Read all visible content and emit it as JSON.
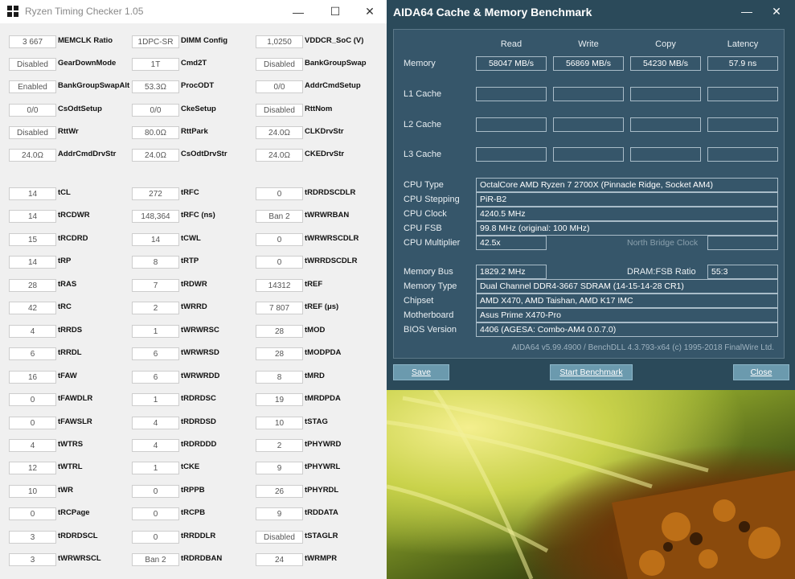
{
  "rtc": {
    "title": "Ryzen Timing Checker 1.05",
    "window_controls": {
      "minimize": "—",
      "maximize": "☐",
      "close": "✕"
    },
    "top_rows": [
      [
        {
          "v": "3 667",
          "l": "MEMCLK Ratio"
        },
        {
          "v": "1DPC-SR",
          "l": "DIMM Config"
        },
        {
          "v": "1,0250",
          "l": "VDDCR_SoC (V)"
        }
      ],
      [
        {
          "v": "Disabled",
          "l": "GearDownMode"
        },
        {
          "v": "1T",
          "l": "Cmd2T"
        },
        {
          "v": "Disabled",
          "l": "BankGroupSwap"
        }
      ],
      [
        {
          "v": "Enabled",
          "l": "BankGroupSwapAlt"
        },
        {
          "v": "53.3Ω",
          "l": "ProcODT"
        },
        {
          "v": "0/0",
          "l": "AddrCmdSetup"
        }
      ],
      [
        {
          "v": "0/0",
          "l": "CsOdtSetup"
        },
        {
          "v": "0/0",
          "l": "CkeSetup"
        },
        {
          "v": "Disabled",
          "l": "RttNom"
        }
      ],
      [
        {
          "v": "Disabled",
          "l": "RttWr"
        },
        {
          "v": "80.0Ω",
          "l": "RttPark"
        },
        {
          "v": "24.0Ω",
          "l": "CLKDrvStr"
        }
      ],
      [
        {
          "v": "24.0Ω",
          "l": "AddrCmdDrvStr"
        },
        {
          "v": "24.0Ω",
          "l": "CsOdtDrvStr"
        },
        {
          "v": "24.0Ω",
          "l": "CKEDrvStr"
        }
      ]
    ],
    "timing_rows": [
      [
        {
          "v": "14",
          "l": "tCL"
        },
        {
          "v": "272",
          "l": "tRFC"
        },
        {
          "v": "0",
          "l": "tRDRDSCDLR"
        }
      ],
      [
        {
          "v": "14",
          "l": "tRCDWR"
        },
        {
          "v": "148,364",
          "l": "tRFC (ns)"
        },
        {
          "v": "Ban 2",
          "l": "tWRWRBAN"
        }
      ],
      [
        {
          "v": "15",
          "l": "tRCDRD"
        },
        {
          "v": "14",
          "l": "tCWL"
        },
        {
          "v": "0",
          "l": "tWRWRSCDLR"
        }
      ],
      [
        {
          "v": "14",
          "l": "tRP"
        },
        {
          "v": "8",
          "l": "tRTP"
        },
        {
          "v": "0",
          "l": "tWRRDSCDLR"
        }
      ],
      [
        {
          "v": "28",
          "l": "tRAS"
        },
        {
          "v": "7",
          "l": "tRDWR"
        },
        {
          "v": "14312",
          "l": "tREF"
        }
      ],
      [
        {
          "v": "42",
          "l": "tRC"
        },
        {
          "v": "2",
          "l": "tWRRD"
        },
        {
          "v": "7 807",
          "l": "tREF (μs)"
        }
      ],
      [
        {
          "v": "4",
          "l": "tRRDS"
        },
        {
          "v": "1",
          "l": "tWRWRSC"
        },
        {
          "v": "28",
          "l": "tMOD"
        }
      ],
      [
        {
          "v": "6",
          "l": "tRRDL"
        },
        {
          "v": "6",
          "l": "tWRWRSD"
        },
        {
          "v": "28",
          "l": "tMODPDA"
        }
      ],
      [
        {
          "v": "16",
          "l": "tFAW"
        },
        {
          "v": "6",
          "l": "tWRWRDD"
        },
        {
          "v": "8",
          "l": "tMRD"
        }
      ],
      [
        {
          "v": "0",
          "l": "tFAWDLR"
        },
        {
          "v": "1",
          "l": "tRDRDSC"
        },
        {
          "v": "19",
          "l": "tMRDPDA"
        }
      ],
      [
        {
          "v": "0",
          "l": "tFAWSLR"
        },
        {
          "v": "4",
          "l": "tRDRDSD"
        },
        {
          "v": "10",
          "l": "tSTAG"
        }
      ],
      [
        {
          "v": "4",
          "l": "tWTRS"
        },
        {
          "v": "4",
          "l": "tRDRDDD"
        },
        {
          "v": "2",
          "l": "tPHYWRD"
        }
      ],
      [
        {
          "v": "12",
          "l": "tWTRL"
        },
        {
          "v": "1",
          "l": "tCKE"
        },
        {
          "v": "9",
          "l": "tPHYWRL"
        }
      ],
      [
        {
          "v": "10",
          "l": "tWR"
        },
        {
          "v": "0",
          "l": "tRPPB"
        },
        {
          "v": "26",
          "l": "tPHYRDL"
        }
      ],
      [
        {
          "v": "0",
          "l": "tRCPage"
        },
        {
          "v": "0",
          "l": "tRCPB"
        },
        {
          "v": "9",
          "l": "tRDDATA"
        }
      ],
      [
        {
          "v": "3",
          "l": "tRDRDSCL"
        },
        {
          "v": "0",
          "l": "tRRDDLR"
        },
        {
          "v": "Disabled",
          "l": "tSTAGLR"
        }
      ],
      [
        {
          "v": "3",
          "l": "tWRWRSCL"
        },
        {
          "v": "Ban 2",
          "l": "tRDRDBAN"
        },
        {
          "v": "24",
          "l": "tWRMPR"
        }
      ]
    ]
  },
  "aida": {
    "title": "AIDA64 Cache & Memory Benchmark",
    "window_controls": {
      "minimize": "—",
      "close": "✕"
    },
    "headers": [
      "Read",
      "Write",
      "Copy",
      "Latency"
    ],
    "bench_rows": [
      {
        "label": "Memory",
        "values": [
          "58047 MB/s",
          "56869 MB/s",
          "54230 MB/s",
          "57.9 ns"
        ]
      },
      {
        "label": "L1 Cache",
        "values": [
          "",
          "",
          "",
          ""
        ]
      },
      {
        "label": "L2 Cache",
        "values": [
          "",
          "",
          "",
          ""
        ]
      },
      {
        "label": "L3 Cache",
        "values": [
          "",
          "",
          "",
          ""
        ]
      }
    ],
    "info": {
      "cpu_type_label": "CPU Type",
      "cpu_type": "OctalCore AMD Ryzen 7 2700X  (Pinnacle Ridge, Socket AM4)",
      "cpu_stepping_label": "CPU Stepping",
      "cpu_stepping": "PiR-B2",
      "cpu_clock_label": "CPU Clock",
      "cpu_clock": "4240.5 MHz",
      "cpu_fsb_label": "CPU FSB",
      "cpu_fsb": "99.8 MHz  (original: 100 MHz)",
      "cpu_multiplier_label": "CPU Multiplier",
      "cpu_multiplier": "42.5x",
      "nb_clock_label": "North Bridge Clock",
      "memory_bus_label": "Memory Bus",
      "memory_bus": "1829.2 MHz",
      "dram_fsb_label": "DRAM:FSB Ratio",
      "dram_fsb": "55:3",
      "memory_type_label": "Memory Type",
      "memory_type": "Dual Channel DDR4-3667 SDRAM  (14-15-14-28 CR1)",
      "chipset_label": "Chipset",
      "chipset": "AMD X470, AMD Taishan, AMD K17 IMC",
      "motherboard_label": "Motherboard",
      "motherboard": "Asus Prime X470-Pro",
      "bios_label": "BIOS Version",
      "bios": "4406  (AGESA: Combo-AM4 0.0.7.0)"
    },
    "footer": "AIDA64 v5.99.4900 / BenchDLL 4.3.793-x64  (c) 1995-2018 FinalWire Ltd.",
    "buttons": {
      "save": "Save",
      "start": "Start Benchmark",
      "close": "Close"
    }
  }
}
